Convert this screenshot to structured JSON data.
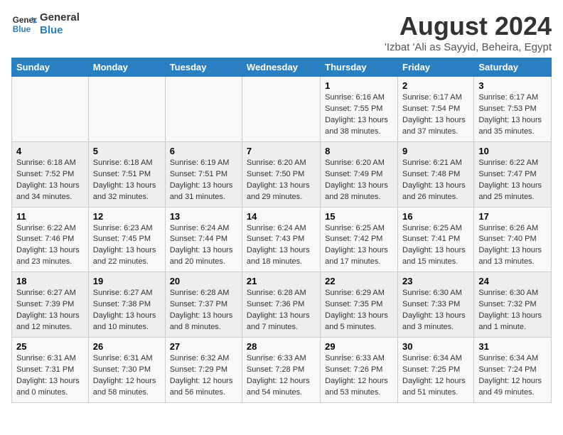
{
  "logo": {
    "line1": "General",
    "line2": "Blue"
  },
  "title": "August 2024",
  "subtitle": "'Izbat 'Ali as Sayyid, Beheira, Egypt",
  "days_of_week": [
    "Sunday",
    "Monday",
    "Tuesday",
    "Wednesday",
    "Thursday",
    "Friday",
    "Saturday"
  ],
  "weeks": [
    [
      {
        "day": "",
        "info": ""
      },
      {
        "day": "",
        "info": ""
      },
      {
        "day": "",
        "info": ""
      },
      {
        "day": "",
        "info": ""
      },
      {
        "day": "1",
        "info": "Sunrise: 6:16 AM\nSunset: 7:55 PM\nDaylight: 13 hours and 38 minutes."
      },
      {
        "day": "2",
        "info": "Sunrise: 6:17 AM\nSunset: 7:54 PM\nDaylight: 13 hours and 37 minutes."
      },
      {
        "day": "3",
        "info": "Sunrise: 6:17 AM\nSunset: 7:53 PM\nDaylight: 13 hours and 35 minutes."
      }
    ],
    [
      {
        "day": "4",
        "info": "Sunrise: 6:18 AM\nSunset: 7:52 PM\nDaylight: 13 hours and 34 minutes."
      },
      {
        "day": "5",
        "info": "Sunrise: 6:18 AM\nSunset: 7:51 PM\nDaylight: 13 hours and 32 minutes."
      },
      {
        "day": "6",
        "info": "Sunrise: 6:19 AM\nSunset: 7:51 PM\nDaylight: 13 hours and 31 minutes."
      },
      {
        "day": "7",
        "info": "Sunrise: 6:20 AM\nSunset: 7:50 PM\nDaylight: 13 hours and 29 minutes."
      },
      {
        "day": "8",
        "info": "Sunrise: 6:20 AM\nSunset: 7:49 PM\nDaylight: 13 hours and 28 minutes."
      },
      {
        "day": "9",
        "info": "Sunrise: 6:21 AM\nSunset: 7:48 PM\nDaylight: 13 hours and 26 minutes."
      },
      {
        "day": "10",
        "info": "Sunrise: 6:22 AM\nSunset: 7:47 PM\nDaylight: 13 hours and 25 minutes."
      }
    ],
    [
      {
        "day": "11",
        "info": "Sunrise: 6:22 AM\nSunset: 7:46 PM\nDaylight: 13 hours and 23 minutes."
      },
      {
        "day": "12",
        "info": "Sunrise: 6:23 AM\nSunset: 7:45 PM\nDaylight: 13 hours and 22 minutes."
      },
      {
        "day": "13",
        "info": "Sunrise: 6:24 AM\nSunset: 7:44 PM\nDaylight: 13 hours and 20 minutes."
      },
      {
        "day": "14",
        "info": "Sunrise: 6:24 AM\nSunset: 7:43 PM\nDaylight: 13 hours and 18 minutes."
      },
      {
        "day": "15",
        "info": "Sunrise: 6:25 AM\nSunset: 7:42 PM\nDaylight: 13 hours and 17 minutes."
      },
      {
        "day": "16",
        "info": "Sunrise: 6:25 AM\nSunset: 7:41 PM\nDaylight: 13 hours and 15 minutes."
      },
      {
        "day": "17",
        "info": "Sunrise: 6:26 AM\nSunset: 7:40 PM\nDaylight: 13 hours and 13 minutes."
      }
    ],
    [
      {
        "day": "18",
        "info": "Sunrise: 6:27 AM\nSunset: 7:39 PM\nDaylight: 13 hours and 12 minutes."
      },
      {
        "day": "19",
        "info": "Sunrise: 6:27 AM\nSunset: 7:38 PM\nDaylight: 13 hours and 10 minutes."
      },
      {
        "day": "20",
        "info": "Sunrise: 6:28 AM\nSunset: 7:37 PM\nDaylight: 13 hours and 8 minutes."
      },
      {
        "day": "21",
        "info": "Sunrise: 6:28 AM\nSunset: 7:36 PM\nDaylight: 13 hours and 7 minutes."
      },
      {
        "day": "22",
        "info": "Sunrise: 6:29 AM\nSunset: 7:35 PM\nDaylight: 13 hours and 5 minutes."
      },
      {
        "day": "23",
        "info": "Sunrise: 6:30 AM\nSunset: 7:33 PM\nDaylight: 13 hours and 3 minutes."
      },
      {
        "day": "24",
        "info": "Sunrise: 6:30 AM\nSunset: 7:32 PM\nDaylight: 13 hours and 1 minute."
      }
    ],
    [
      {
        "day": "25",
        "info": "Sunrise: 6:31 AM\nSunset: 7:31 PM\nDaylight: 13 hours and 0 minutes."
      },
      {
        "day": "26",
        "info": "Sunrise: 6:31 AM\nSunset: 7:30 PM\nDaylight: 12 hours and 58 minutes."
      },
      {
        "day": "27",
        "info": "Sunrise: 6:32 AM\nSunset: 7:29 PM\nDaylight: 12 hours and 56 minutes."
      },
      {
        "day": "28",
        "info": "Sunrise: 6:33 AM\nSunset: 7:28 PM\nDaylight: 12 hours and 54 minutes."
      },
      {
        "day": "29",
        "info": "Sunrise: 6:33 AM\nSunset: 7:26 PM\nDaylight: 12 hours and 53 minutes."
      },
      {
        "day": "30",
        "info": "Sunrise: 6:34 AM\nSunset: 7:25 PM\nDaylight: 12 hours and 51 minutes."
      },
      {
        "day": "31",
        "info": "Sunrise: 6:34 AM\nSunset: 7:24 PM\nDaylight: 12 hours and 49 minutes."
      }
    ]
  ]
}
